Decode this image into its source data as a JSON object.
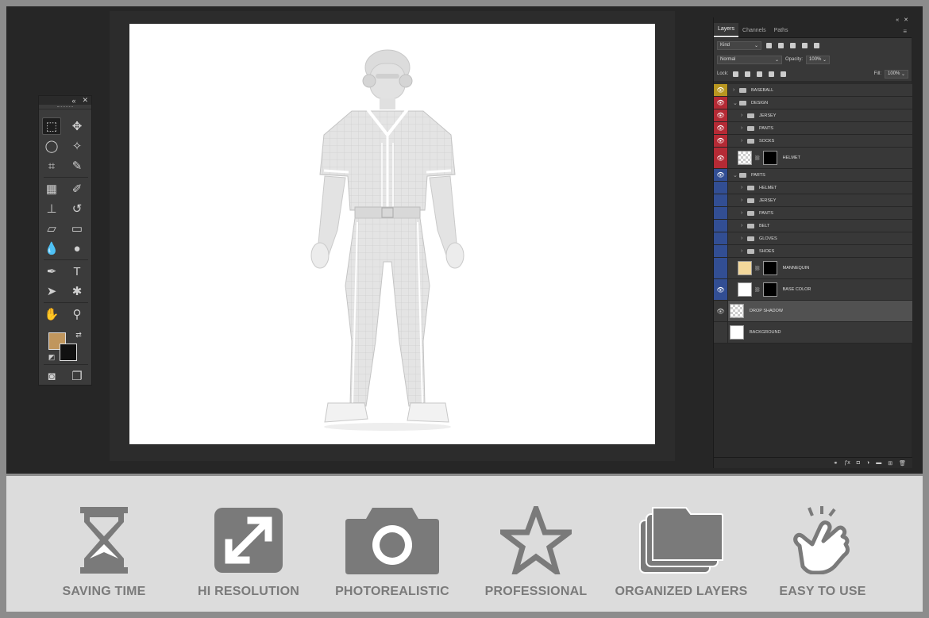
{
  "layers_panel": {
    "tabs": [
      "Layers",
      "Channels",
      "Paths"
    ],
    "filter_kind": "Kind",
    "blend_mode": "Normal",
    "opacity_label": "Opacity:",
    "opacity_value": "100%",
    "lock_label": "Lock:",
    "fill_label": "Fill:",
    "fill_value": "100%",
    "layers": [
      {
        "name": "BASEBALL",
        "tag": "yellow"
      },
      {
        "name": "DESIGN",
        "tag": "red"
      },
      {
        "name": "JERSEY",
        "tag": "red"
      },
      {
        "name": "PANTS",
        "tag": "red"
      },
      {
        "name": "SOCKS",
        "tag": "red"
      },
      {
        "name": "HELMET",
        "tag": "red"
      },
      {
        "name": "PARTS",
        "tag": "blue"
      },
      {
        "name": "HELMET",
        "tag": "blue"
      },
      {
        "name": "JERSEY",
        "tag": "blue"
      },
      {
        "name": "PANTS",
        "tag": "blue"
      },
      {
        "name": "BELT",
        "tag": "blue"
      },
      {
        "name": "GLOVES",
        "tag": "blue"
      },
      {
        "name": "SHOES",
        "tag": "blue"
      },
      {
        "name": "MANNEQUIN",
        "tag": "blue"
      },
      {
        "name": "BASE COLOR",
        "tag": "blue"
      },
      {
        "name": "DROP SHADOW",
        "tag": "none"
      },
      {
        "name": "BACKGROUND",
        "tag": "none"
      }
    ]
  },
  "toolbar": {
    "foreground_color": "#c0965d",
    "background_color": "#111111"
  },
  "features": [
    {
      "label": "SAVING TIME",
      "icon": "hourglass-icon"
    },
    {
      "label": "HI RESOLUTION",
      "icon": "expand-arrows-icon"
    },
    {
      "label": "PHOTOREALISTIC",
      "icon": "camera-icon"
    },
    {
      "label": "PROFESSIONAL",
      "icon": "star-icon"
    },
    {
      "label": "ORGANIZED LAYERS",
      "icon": "layers-icon"
    },
    {
      "label": "EASY TO USE",
      "icon": "tap-hand-icon"
    }
  ],
  "colors": {
    "tag_yellow": "#b89620",
    "tag_red": "#b52a35",
    "tag_blue": "#324e93",
    "feature_gray": "#7a7a7a"
  }
}
